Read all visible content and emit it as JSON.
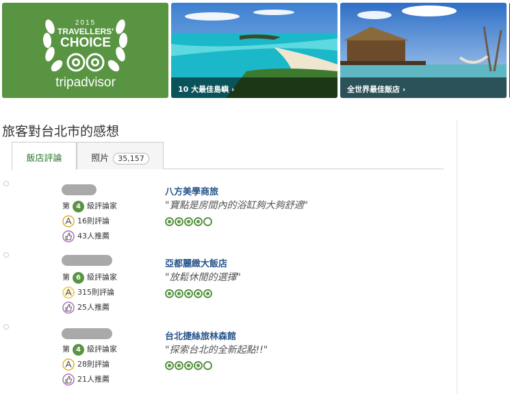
{
  "banners": {
    "badge": {
      "year": "2015",
      "line1": "TRAVELLERS'",
      "line2": "CHOICE",
      "brand": "tripadvisor"
    },
    "tiles": [
      {
        "caption": "10 大最佳島嶼 ›"
      },
      {
        "caption": "全世界最佳飯店 ›"
      }
    ]
  },
  "section": {
    "title": "旅客對台北市的感想"
  },
  "tabs": {
    "reviews_label": "飯店評論",
    "photos_label": "照片",
    "photos_count": "35,157"
  },
  "reviews": [
    {
      "level_prefix": "第",
      "level": "4",
      "level_suffix": "級評論家",
      "review_count": "16則評論",
      "likes": "43人推薦",
      "hotel": "八方美學商旅",
      "quote": "寶點是房間內的浴缸夠大夠舒適",
      "rating": 4
    },
    {
      "level_prefix": "第",
      "level": "6",
      "level_suffix": "級評論家",
      "review_count": "315則評論",
      "likes": "25人推薦",
      "hotel": "亞都麗緻大飯店",
      "quote": "放鬆休閒的選擇",
      "rating": 5
    },
    {
      "level_prefix": "第",
      "level": "4",
      "level_suffix": "級評論家",
      "review_count": "28則評論",
      "likes": "21人推薦",
      "hotel": "台北捷絲旅林森館",
      "quote": "探索台北的全新起點!!",
      "rating": 4
    }
  ],
  "colors": {
    "brand_green": "#589442",
    "link_blue": "#26538a"
  }
}
